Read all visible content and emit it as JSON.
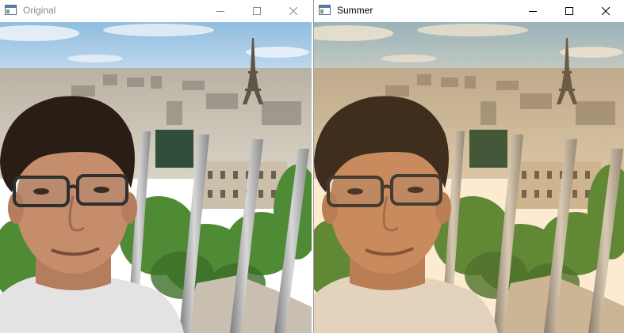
{
  "windows": [
    {
      "title": "Original",
      "controls": [
        "minimize-icon",
        "maximize-icon",
        "close-icon"
      ],
      "title_color": "#8a8a8a"
    },
    {
      "title": "Summer",
      "controls": [
        "minimize-icon",
        "maximize-icon",
        "close-icon"
      ],
      "title_color": "#000000"
    }
  ],
  "colors": {
    "sky": "#aecde8",
    "hair": "#2a1d16",
    "skin": "#c58d6b",
    "foliage": "#4f8a35",
    "railing": "#a9a9a9",
    "shirt": "#e3e3e3",
    "summer_tint": "#f0a028"
  }
}
